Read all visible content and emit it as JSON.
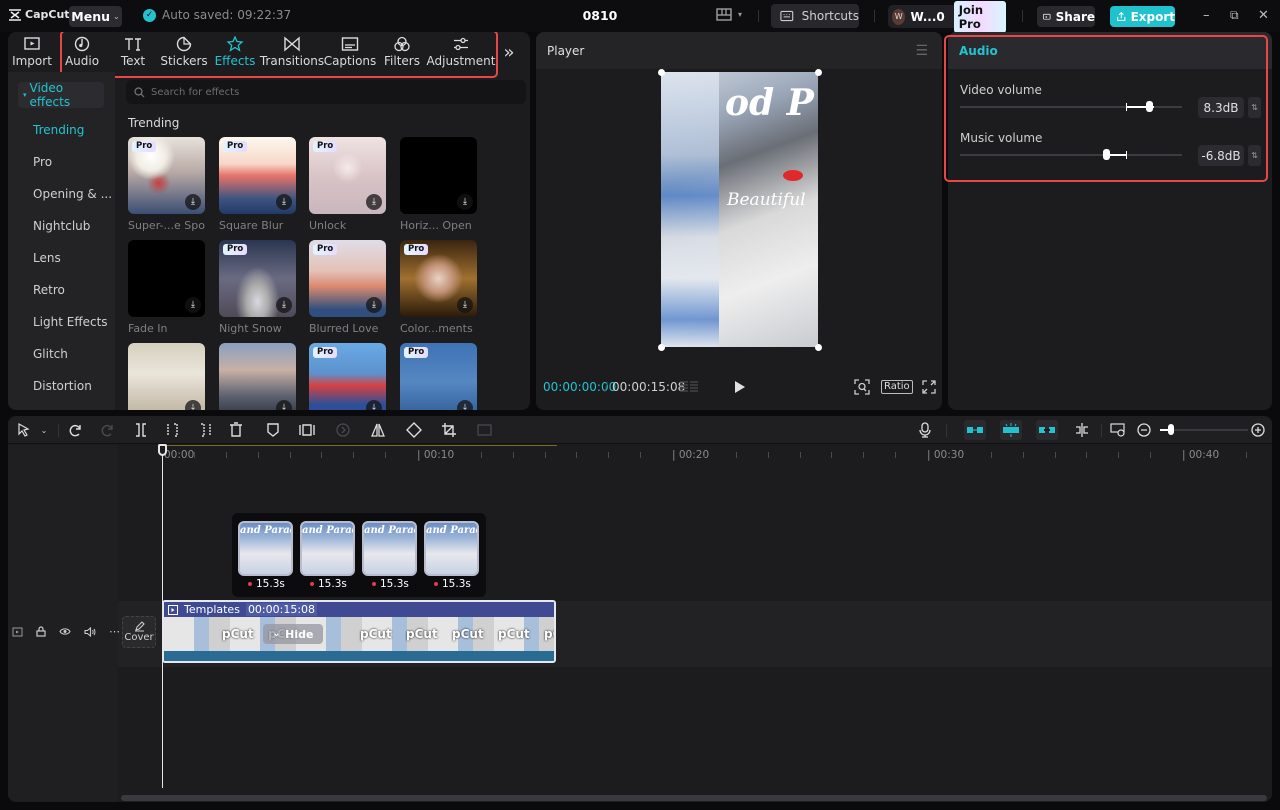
{
  "titlebar": {
    "app_name": "CapCut",
    "menu_label": "Menu",
    "autosave_text": "Auto saved: 09:22:37",
    "project_title": "0810",
    "shortcuts_label": "Shortcuts",
    "user_initial": "W",
    "user_name": "W...0",
    "join_pro_label": "Join Pro",
    "share_label": "Share",
    "export_label": "Export"
  },
  "media_toolbar": {
    "tabs": [
      {
        "label": "Import",
        "icon": "import-icon",
        "active": false
      },
      {
        "label": "Audio",
        "icon": "audio-icon",
        "active": false
      },
      {
        "label": "Text",
        "icon": "text-icon",
        "active": false
      },
      {
        "label": "Stickers",
        "icon": "sticker-icon",
        "active": false
      },
      {
        "label": "Effects",
        "icon": "effects-icon",
        "active": true
      },
      {
        "label": "Transitions",
        "icon": "transitions-icon",
        "active": false
      },
      {
        "label": "Captions",
        "icon": "captions-icon",
        "active": false
      },
      {
        "label": "Filters",
        "icon": "filters-icon",
        "active": false
      },
      {
        "label": "Adjustment",
        "icon": "adjustment-icon",
        "active": false
      }
    ],
    "more_label": "»"
  },
  "effects_sidebar": {
    "category_header": "Video effects",
    "items": [
      "Trending",
      "Pro",
      "Opening & ...",
      "Nightclub",
      "Lens",
      "Retro",
      "Light Effects",
      "Glitch",
      "Distortion"
    ],
    "active": "Trending"
  },
  "effects_panel": {
    "search_placeholder": "Search for effects",
    "section_title": "Trending",
    "pro_badge": "Pro",
    "cards": [
      {
        "name": "Super-...e Spot",
        "pro": true
      },
      {
        "name": "Square Blur",
        "pro": true
      },
      {
        "name": "Unlock",
        "pro": true
      },
      {
        "name": "Horiz... Open",
        "pro": false
      },
      {
        "name": "Fade In",
        "pro": false
      },
      {
        "name": "Night Snow",
        "pro": true
      },
      {
        "name": "Blurred Love",
        "pro": true
      },
      {
        "name": "Color...ments",
        "pro": true
      },
      {
        "name": "",
        "pro": false
      },
      {
        "name": "",
        "pro": false
      },
      {
        "name": "",
        "pro": true
      },
      {
        "name": "",
        "pro": true
      }
    ]
  },
  "player": {
    "title": "Player",
    "current_time": "00:00:00:00",
    "total_time": "00:00:15:08",
    "ratio_label": "Ratio",
    "preview_text_top": "od P",
    "preview_text_script": "Beautiful"
  },
  "audio_panel": {
    "title": "Audio",
    "video_volume_label": "Video volume",
    "video_volume_value": "8.3dB",
    "video_volume_db": 8.3,
    "music_volume_label": "Music volume",
    "music_volume_value": "-6.8dB",
    "music_volume_db": -6.8
  },
  "timeline": {
    "ruler_labels": [
      "00:00",
      "00:10",
      "00:20",
      "00:30",
      "00:40"
    ],
    "zoom_level_fraction": 0.05,
    "clip": {
      "label": "Templates",
      "duration": "00:00:15:08",
      "hide_label": "Hide",
      "frame_text": "pCut"
    },
    "popover_items": [
      {
        "title": "and Paradis",
        "duration": "15.3s"
      },
      {
        "title": "and Paradis",
        "duration": "15.3s"
      },
      {
        "title": "and Paradis",
        "duration": "15.3s"
      },
      {
        "title": "and Paradis",
        "duration": "15.3s"
      }
    ],
    "cover_label": "Cover"
  },
  "colors": {
    "accent": "#22c3cf",
    "highlight_box": "#e8474a",
    "clip_header": "#3f4a93"
  }
}
